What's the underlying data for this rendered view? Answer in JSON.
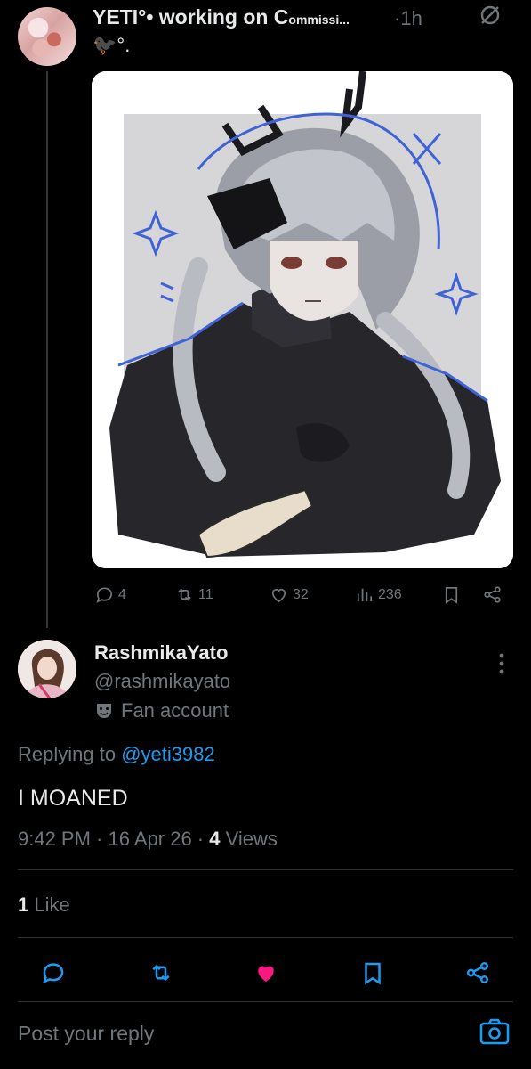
{
  "original_post": {
    "author_name": "YETI°• working on C",
    "author_name_small": "ommissi...",
    "time_sep": "·",
    "time": "1h",
    "subtitle": "🐦‍⬛°.",
    "stats": {
      "replies": "4",
      "reposts": "11",
      "likes": "32",
      "views": "236"
    }
  },
  "reply": {
    "name": "RashmikaYato",
    "handle": "@rashmikayato",
    "badge_label": "Fan account",
    "replying_to_prefix": "Replying to ",
    "replying_to_handle": "@yeti3982",
    "text": "I MOANED",
    "time": "9:42 PM",
    "sep": " · ",
    "date": "16 Apr 26",
    "views_count": "4",
    "views_label": " Views",
    "likes_count": "1",
    "likes_label": " Like"
  },
  "composer": {
    "placeholder": "Post your reply"
  },
  "colors": {
    "accent": "#1d9bf0",
    "like_pink": "#f91880",
    "muted": "#71767b"
  }
}
